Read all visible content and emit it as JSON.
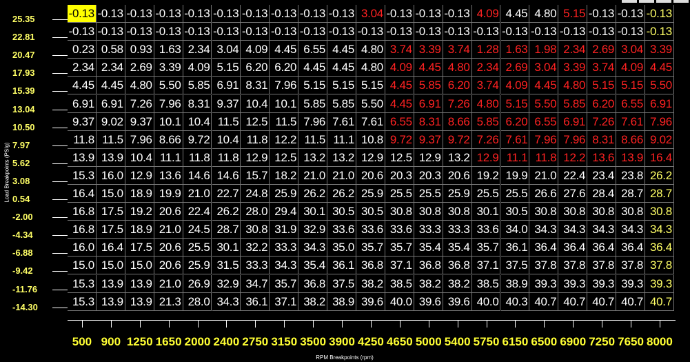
{
  "axes": {
    "y_title": "Load Breakpoints (PSIg)",
    "x_title": "RPM Breakpoints (rpm)",
    "load_breakpoints": [
      "25.35",
      "22.81",
      "20.47",
      "17.93",
      "15.39",
      "13.04",
      "10.50",
      "7.97",
      "5.62",
      "3.08",
      "0.54",
      "-2.00",
      "-4.34",
      "-6.88",
      "-9.42",
      "-11.76",
      "-14.30"
    ],
    "rpm_breakpoints": [
      "500",
      "900",
      "1250",
      "1650",
      "2000",
      "2400",
      "2750",
      "3150",
      "3500",
      "3900",
      "4250",
      "4650",
      "5000",
      "5400",
      "5750",
      "6150",
      "6500",
      "6900",
      "7250",
      "7650",
      "8000"
    ]
  },
  "table": {
    "selected_cell": [
      0,
      0
    ],
    "rows": [
      [
        "-0.13",
        "-0.13",
        "-0.13",
        "-0.13",
        "-0.13",
        "-0.13",
        "-0.13",
        "-0.13",
        "-0.13",
        "-0.13",
        "3.04",
        "-0.13",
        "-0.13",
        "-0.13",
        "4.09",
        "4.45",
        "4.80",
        "5.15",
        "-0.13",
        "-0.13",
        "-0.13",
        "-0.13"
      ],
      [
        "-0.13",
        "-0.13",
        "-0.13",
        "-0.13",
        "-0.13",
        "-0.13",
        "-0.13",
        "-0.13",
        "-0.13",
        "-0.13",
        "-0.13",
        "-0.13",
        "-0.13",
        "-0.13",
        "-0.13",
        "-0.13",
        "-0.13",
        "-0.13",
        "-0.13",
        "-0.13",
        "-0.13"
      ],
      [
        "0.23",
        "0.58",
        "0.93",
        "1.63",
        "2.34",
        "3.04",
        "4.09",
        "4.45",
        "6.55",
        "4.45",
        "4.80",
        "3.74",
        "3.39",
        "3.74",
        "1.28",
        "1.63",
        "1.98",
        "2.34",
        "2.69",
        "3.04",
        "3.39"
      ],
      [
        "2.34",
        "2.34",
        "2.69",
        "3.39",
        "4.09",
        "5.15",
        "6.20",
        "6.20",
        "4.45",
        "4.45",
        "4.80",
        "4.09",
        "4.45",
        "4.80",
        "2.34",
        "2.69",
        "3.04",
        "3.39",
        "3.74",
        "4.09",
        "4.45"
      ],
      [
        "4.45",
        "4.45",
        "4.80",
        "5.50",
        "5.85",
        "6.91",
        "8.31",
        "7.96",
        "5.15",
        "5.15",
        "5.15",
        "4.45",
        "5.85",
        "6.20",
        "3.74",
        "4.09",
        "4.45",
        "4.80",
        "5.15",
        "5.15",
        "5.50"
      ],
      [
        "6.91",
        "6.91",
        "7.26",
        "7.96",
        "8.31",
        "9.37",
        "10.4",
        "10.1",
        "5.85",
        "5.85",
        "5.50",
        "4.45",
        "6.91",
        "7.26",
        "4.80",
        "5.15",
        "5.50",
        "5.85",
        "6.20",
        "6.55",
        "6.91"
      ],
      [
        "9.37",
        "9.02",
        "9.37",
        "10.1",
        "10.4",
        "11.5",
        "12.5",
        "11.5",
        "7.96",
        "7.61",
        "7.61",
        "6.55",
        "8.31",
        "8.66",
        "5.85",
        "6.20",
        "6.55",
        "6.91",
        "7.26",
        "7.61",
        "7.96"
      ],
      [
        "11.8",
        "11.5",
        "7.96",
        "8.66",
        "9.72",
        "10.4",
        "11.8",
        "12.2",
        "11.5",
        "11.1",
        "10.8",
        "9.72",
        "9.37",
        "9.72",
        "7.26",
        "7.61",
        "7.96",
        "7.96",
        "8.31",
        "8.66",
        "9.02"
      ],
      [
        "13.9",
        "13.9",
        "10.4",
        "11.1",
        "11.8",
        "11.8",
        "12.9",
        "12.5",
        "13.2",
        "13.2",
        "12.9",
        "12.5",
        "12.9",
        "13.2",
        "12.9",
        "11.1",
        "11.8",
        "12.2",
        "13.6",
        "13.9",
        "16.4"
      ],
      [
        "15.3",
        "16.0",
        "12.9",
        "13.6",
        "14.6",
        "14.6",
        "15.7",
        "18.2",
        "21.0",
        "21.0",
        "20.6",
        "20.3",
        "20.3",
        "20.6",
        "19.2",
        "19.9",
        "21.0",
        "22.4",
        "23.4",
        "23.8",
        "26.2"
      ],
      [
        "16.4",
        "15.0",
        "18.9",
        "19.9",
        "21.0",
        "22.7",
        "24.8",
        "25.9",
        "26.2",
        "26.2",
        "25.9",
        "25.5",
        "25.5",
        "25.9",
        "25.5",
        "25.5",
        "26.6",
        "27.6",
        "28.4",
        "28.7",
        "28.7"
      ],
      [
        "16.8",
        "17.5",
        "19.2",
        "20.6",
        "22.4",
        "26.2",
        "28.0",
        "29.4",
        "30.1",
        "30.5",
        "30.5",
        "30.8",
        "30.8",
        "30.8",
        "30.1",
        "30.5",
        "30.8",
        "30.8",
        "30.8",
        "30.8",
        "30.8"
      ],
      [
        "16.8",
        "17.5",
        "18.9",
        "21.0",
        "24.5",
        "28.7",
        "30.8",
        "31.9",
        "32.9",
        "33.6",
        "33.6",
        "33.6",
        "33.3",
        "33.3",
        "33.6",
        "34.0",
        "34.3",
        "34.3",
        "34.3",
        "34.3",
        "34.3"
      ],
      [
        "16.0",
        "16.4",
        "17.5",
        "20.6",
        "25.5",
        "30.1",
        "32.2",
        "33.3",
        "34.3",
        "35.0",
        "35.7",
        "35.7",
        "35.4",
        "35.4",
        "35.7",
        "36.1",
        "36.4",
        "36.4",
        "36.4",
        "36.4",
        "36.4"
      ],
      [
        "15.0",
        "15.0",
        "15.0",
        "20.6",
        "25.9",
        "31.5",
        "33.3",
        "34.3",
        "35.4",
        "36.1",
        "36.8",
        "37.1",
        "36.8",
        "36.8",
        "37.1",
        "37.5",
        "37.8",
        "37.8",
        "37.8",
        "37.8",
        "37.8"
      ],
      [
        "15.3",
        "13.9",
        "13.9",
        "21.0",
        "26.9",
        "32.9",
        "34.7",
        "35.7",
        "36.8",
        "37.5",
        "38.2",
        "38.5",
        "38.2",
        "38.2",
        "38.5",
        "38.9",
        "39.3",
        "39.3",
        "39.3",
        "39.3",
        "39.3"
      ],
      [
        "15.3",
        "13.9",
        "13.9",
        "21.3",
        "28.0",
        "34.3",
        "36.1",
        "37.1",
        "38.2",
        "38.9",
        "39.6",
        "40.0",
        "39.6",
        "39.6",
        "40.0",
        "40.3",
        "40.7",
        "40.7",
        "40.7",
        "40.7",
        "40.7"
      ]
    ],
    "red_cells": [
      [
        0,
        10
      ],
      [
        0,
        14
      ],
      [
        0,
        17
      ],
      [
        2,
        11
      ],
      [
        2,
        12
      ],
      [
        2,
        13
      ],
      [
        2,
        14
      ],
      [
        2,
        15
      ],
      [
        2,
        16
      ],
      [
        2,
        17
      ],
      [
        2,
        18
      ],
      [
        2,
        19
      ],
      [
        2,
        20
      ],
      [
        3,
        11
      ],
      [
        3,
        12
      ],
      [
        3,
        13
      ],
      [
        3,
        14
      ],
      [
        3,
        15
      ],
      [
        3,
        16
      ],
      [
        3,
        17
      ],
      [
        3,
        18
      ],
      [
        3,
        19
      ],
      [
        3,
        20
      ],
      [
        4,
        11
      ],
      [
        4,
        12
      ],
      [
        4,
        13
      ],
      [
        4,
        14
      ],
      [
        4,
        15
      ],
      [
        4,
        16
      ],
      [
        4,
        17
      ],
      [
        4,
        18
      ],
      [
        4,
        19
      ],
      [
        4,
        20
      ],
      [
        5,
        11
      ],
      [
        5,
        12
      ],
      [
        5,
        13
      ],
      [
        5,
        14
      ],
      [
        5,
        15
      ],
      [
        5,
        16
      ],
      [
        5,
        17
      ],
      [
        5,
        18
      ],
      [
        5,
        19
      ],
      [
        5,
        20
      ],
      [
        6,
        11
      ],
      [
        6,
        12
      ],
      [
        6,
        13
      ],
      [
        6,
        14
      ],
      [
        6,
        15
      ],
      [
        6,
        16
      ],
      [
        6,
        17
      ],
      [
        6,
        18
      ],
      [
        6,
        19
      ],
      [
        6,
        20
      ],
      [
        7,
        11
      ],
      [
        7,
        12
      ],
      [
        7,
        13
      ],
      [
        7,
        14
      ],
      [
        7,
        15
      ],
      [
        7,
        16
      ],
      [
        7,
        17
      ],
      [
        7,
        18
      ],
      [
        7,
        19
      ],
      [
        7,
        20
      ],
      [
        8,
        14
      ],
      [
        8,
        15
      ],
      [
        8,
        16
      ],
      [
        8,
        17
      ],
      [
        8,
        18
      ],
      [
        8,
        19
      ],
      [
        8,
        20
      ]
    ]
  },
  "colors": {
    "background": "#000000",
    "axis_label": "#ffff33",
    "selected_bg": "#ffff00",
    "highlight_text": "#ff2222",
    "grid_line": "#777777"
  }
}
